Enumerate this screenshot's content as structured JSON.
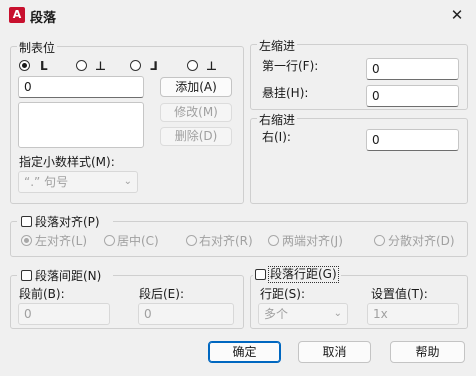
{
  "window": {
    "title": "段落",
    "app_icon_letter": "A",
    "close_glyph": "✕"
  },
  "tab_stops": {
    "legend": "制表位",
    "glyphs": [
      "L",
      "⊥",
      "⅃",
      "⊥"
    ],
    "input_value": "0",
    "add_label": "添加(A)",
    "modify_label": "修改(M)",
    "delete_label": "删除(D)",
    "decimal_label": "指定小数样式(M):",
    "decimal_value": "“.” 句号"
  },
  "left_indent": {
    "legend": "左缩进",
    "first_line_label": "第一行(F):",
    "first_line_value": "0",
    "hanging_label": "悬挂(H):",
    "hanging_value": "0"
  },
  "right_indent": {
    "legend": "右缩进",
    "right_label": "右(I):",
    "right_value": "0"
  },
  "alignment": {
    "checkbox_label": "段落对齐(P)",
    "options": [
      "左对齐(L)",
      "居中(C)",
      "右对齐(R)",
      "两端对齐(J)",
      "分散对齐(D)"
    ]
  },
  "spacing": {
    "checkbox_label": "段落间距(N)",
    "before_label": "段前(B):",
    "before_value": "0",
    "after_label": "段后(E):",
    "after_value": "0"
  },
  "line_spacing": {
    "checkbox_label": "段落行距(G)",
    "line_label": "行距(S):",
    "line_value": "多个",
    "setting_label": "设置值(T):",
    "setting_value": "1x"
  },
  "footer": {
    "ok": "确定",
    "cancel": "取消",
    "help": "帮助"
  }
}
